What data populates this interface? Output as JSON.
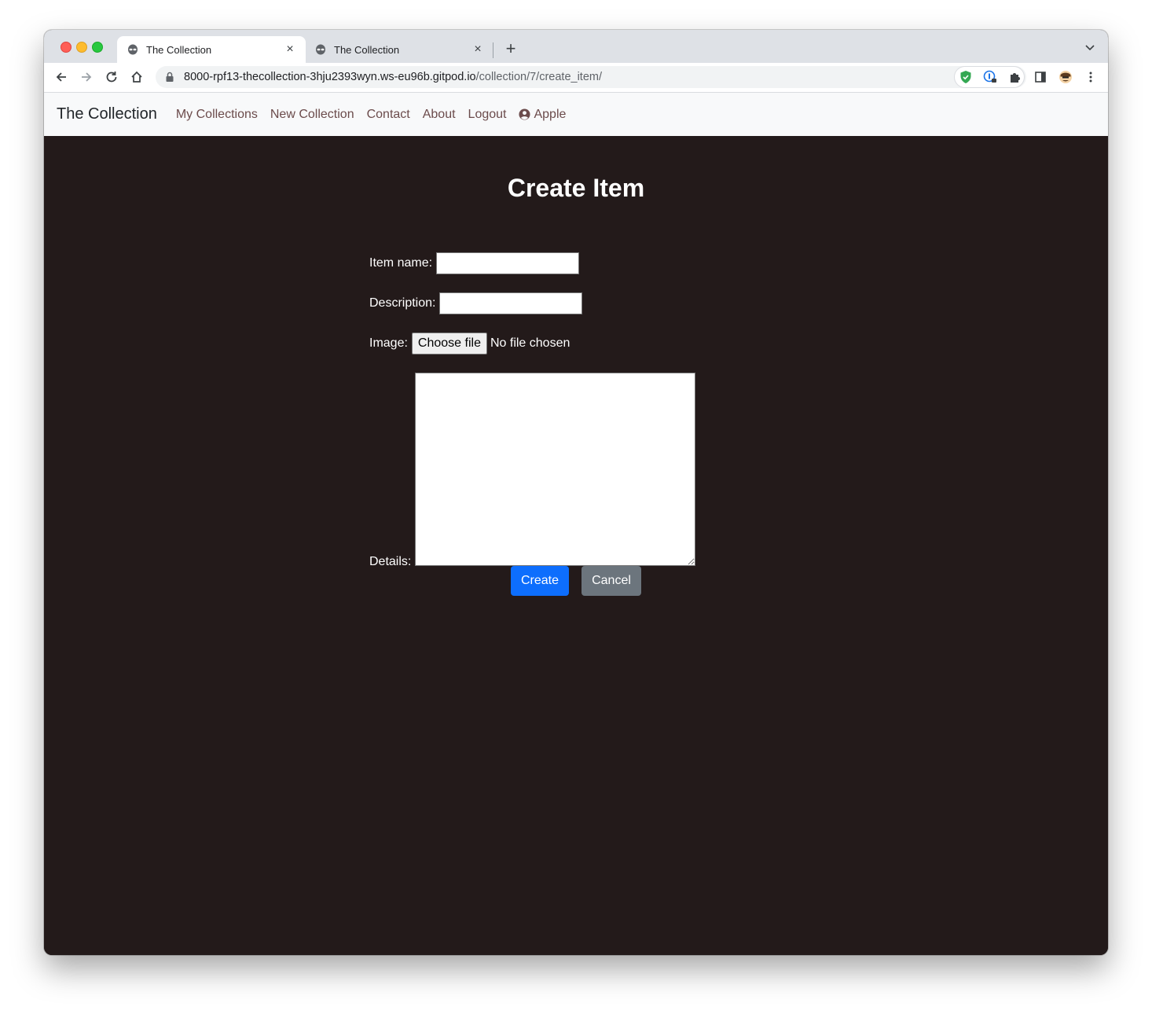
{
  "browser": {
    "tabs": [
      {
        "title": "The Collection",
        "active": true
      },
      {
        "title": "The Collection",
        "active": false
      }
    ],
    "address": {
      "host": "8000-rpf13-thecollection-3hju2393wyn.ws-eu96b.gitpod.io",
      "path": "/collection/7/create_item/"
    }
  },
  "navbar": {
    "brand": "The Collection",
    "links": [
      "My Collections",
      "New Collection",
      "Contact",
      "About",
      "Logout"
    ],
    "user": "Apple"
  },
  "page": {
    "title": "Create Item",
    "fields": {
      "item_name_label": "Item name:",
      "description_label": "Description:",
      "image_label": "Image:",
      "choose_file": "Choose file",
      "no_file": "No file chosen",
      "details_label": "Details:"
    },
    "buttons": {
      "create": "Create",
      "cancel": "Cancel"
    }
  },
  "colors": {
    "page_background": "#231a1a",
    "navbar_background": "#f8f9fa",
    "nav_link": "#6b4b4b",
    "primary": "#0d6efd",
    "secondary": "#6c757d"
  }
}
